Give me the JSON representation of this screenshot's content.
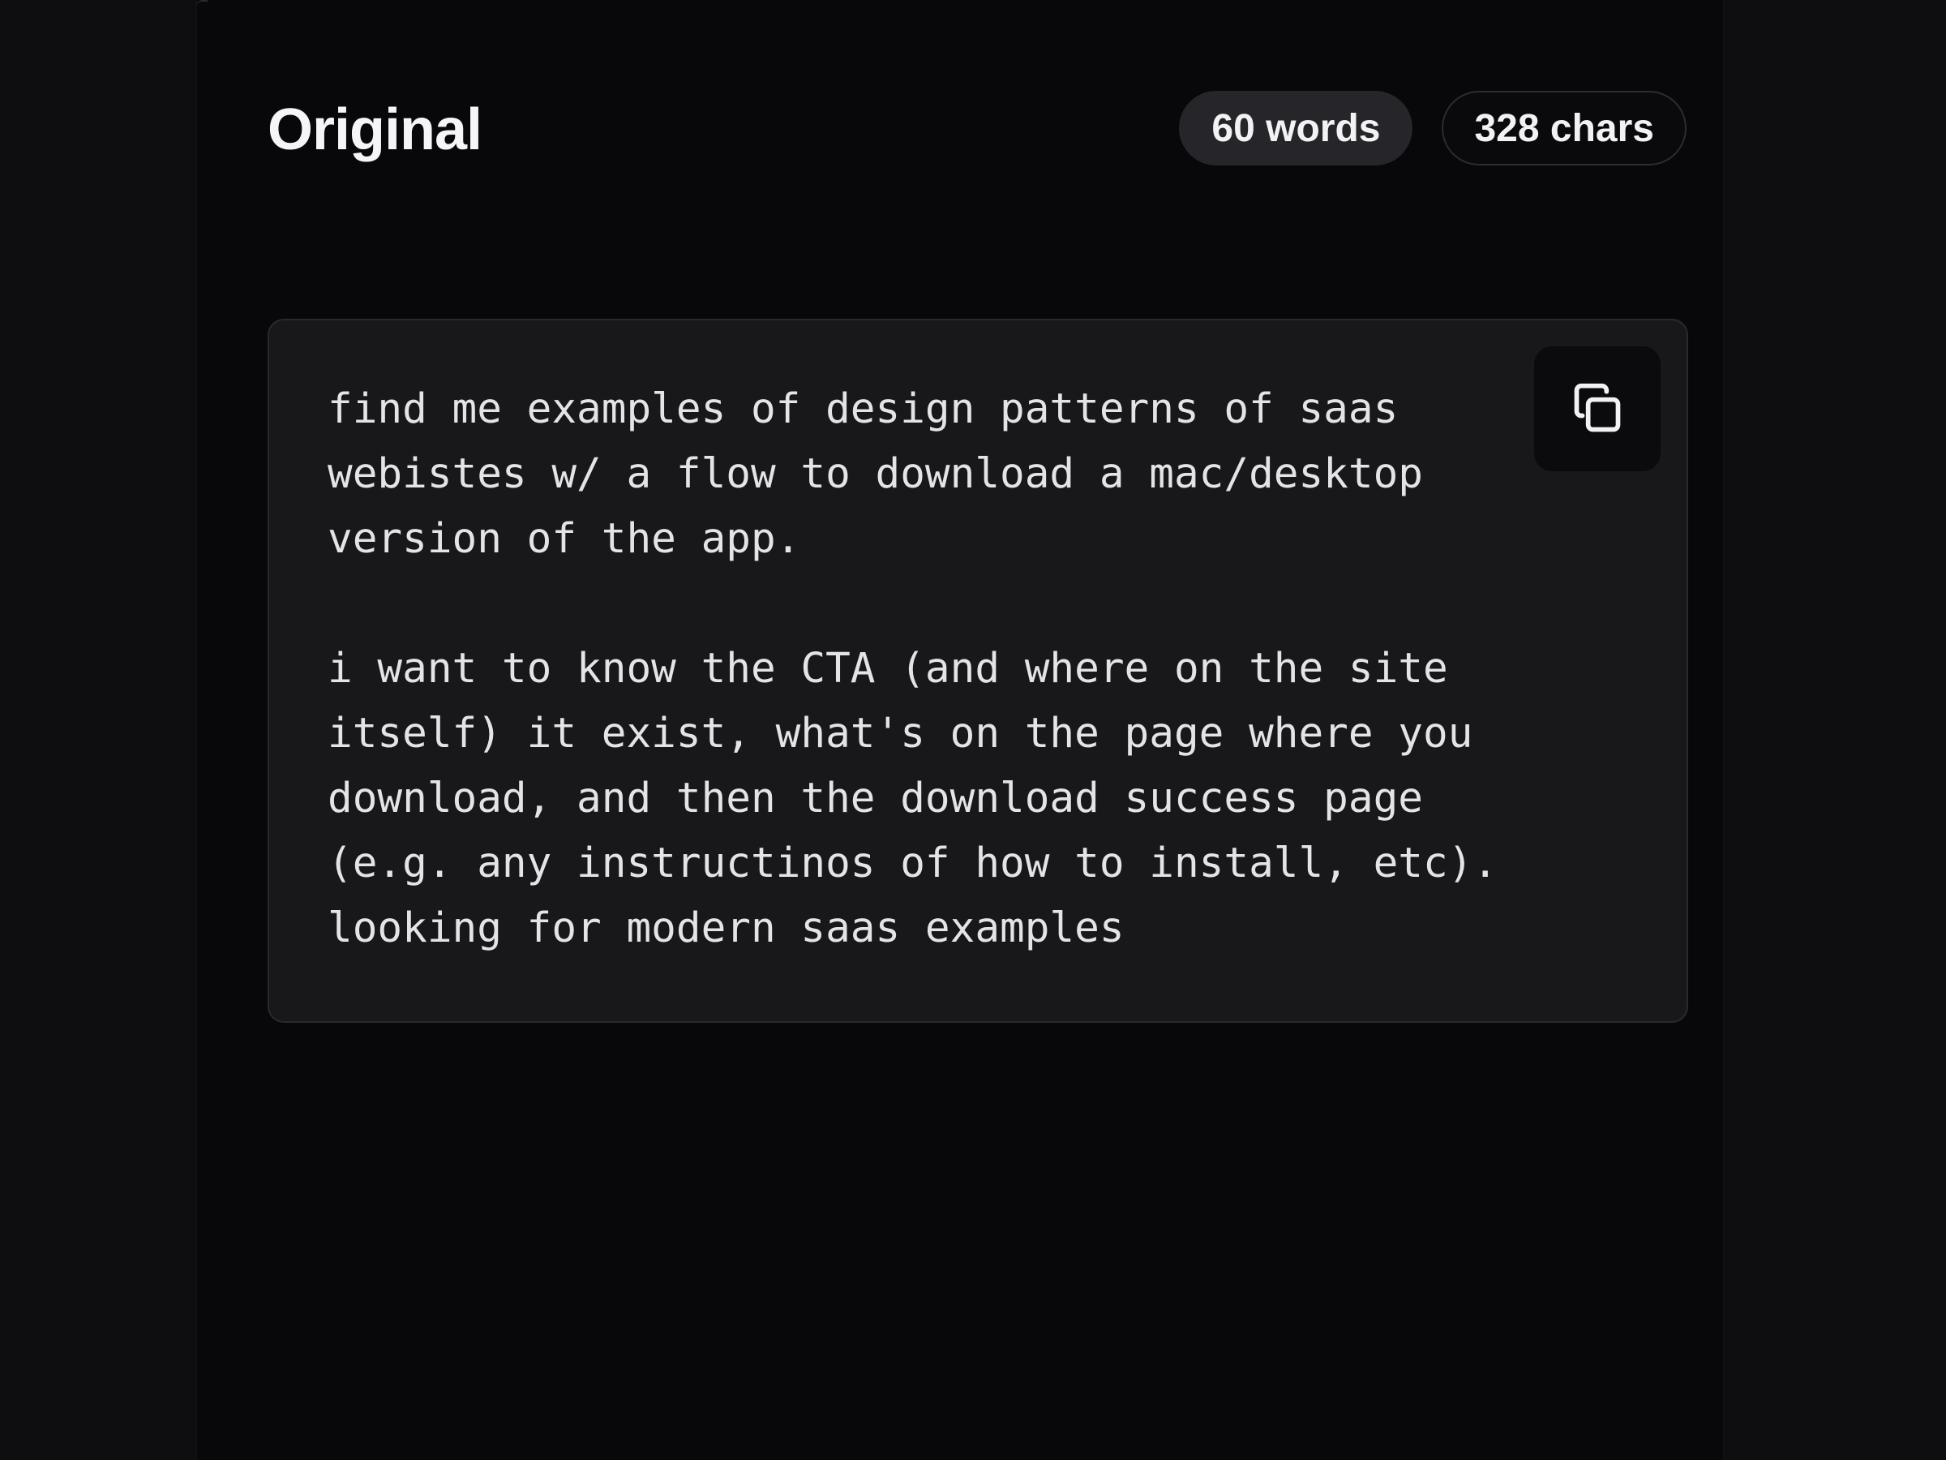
{
  "header": {
    "title": "Original",
    "word_count": "60 words",
    "char_count": "328 chars"
  },
  "prompt": {
    "text": "find me examples of design patterns of saas\nwebistes w/ a flow to download a mac/desktop\nversion of the app.\n\ni want to know the CTA (and where on the site\nitself) it exist, what's on the page where you\ndownload, and then the download success page\n(e.g. any instructinos of how to install, etc).\nlooking for modern saas examples"
  },
  "icons": {
    "copy": "copy-icon"
  },
  "colors": {
    "background": "#08080a",
    "card": "#18181b",
    "pill": "#26262a",
    "text": "#e4e4e8"
  }
}
